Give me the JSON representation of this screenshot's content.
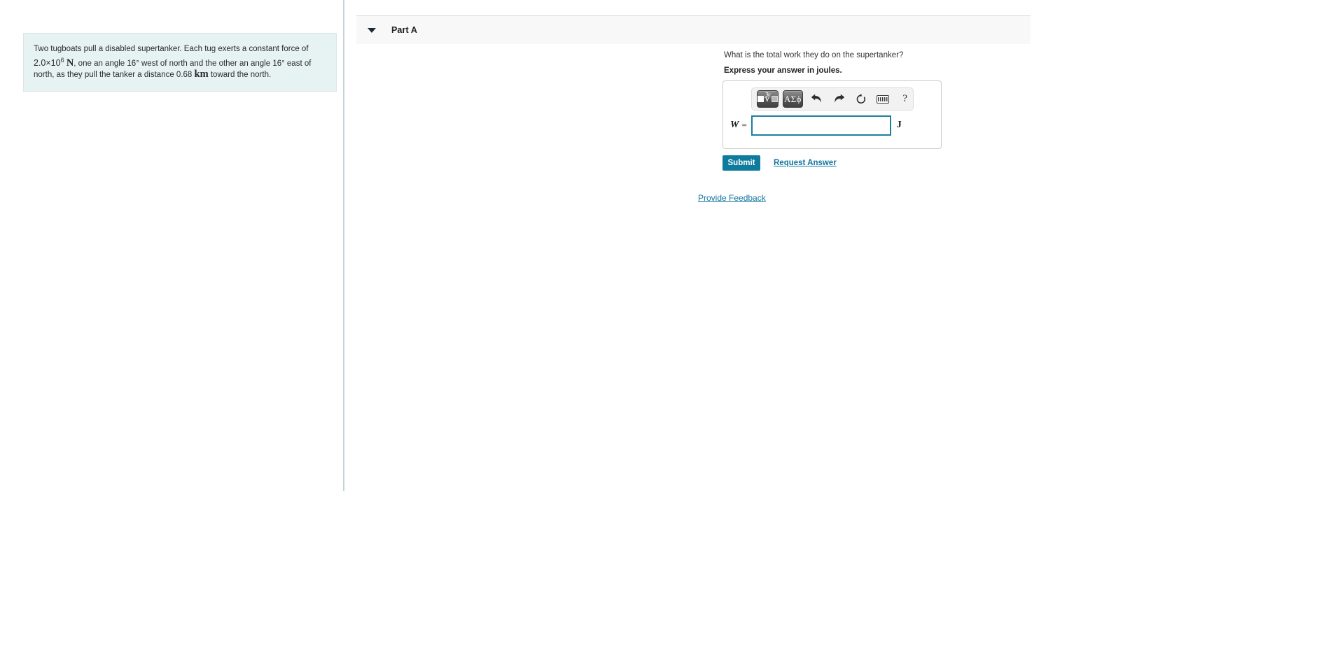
{
  "problem": {
    "text_part1": "Two tugboats pull a disabled supertanker. Each tug exerts a constant force of ",
    "force_value": "2.0×10",
    "force_exponent": "6",
    "force_unit": "N",
    "text_part2": ", one an angle 16",
    "deg1": "°",
    "text_part3": " west of north and the other an angle 16",
    "deg2": "°",
    "text_part4": " east of north, as they pull the tanker a distance 0.68 ",
    "distance_unit": "km",
    "text_part5": " toward the north."
  },
  "part": {
    "title": "Part A",
    "collapse_icon": "triangle-down-icon",
    "question": "What is the total work they do on the supertanker?",
    "instruction": "Express your answer in joules."
  },
  "answer_widget": {
    "toolbar": {
      "template_button_label": "√",
      "template_button_name": "math-template-icon",
      "greek_button_label": "ΑΣϕ",
      "undo_icon": "undo-arrow-icon",
      "redo_icon": "redo-arrow-icon",
      "reset_icon": "reset-circle-icon",
      "keyboard_icon": "keyboard-icon",
      "help_icon": "?"
    },
    "variable_label": "W",
    "equals_label": "=",
    "input_value": "",
    "input_placeholder": "",
    "unit_label": "J"
  },
  "actions": {
    "submit_label": "Submit",
    "request_answer_label": "Request Answer",
    "provide_feedback_label": "Provide Feedback"
  },
  "colors": {
    "accent": "#0f7c9e",
    "link": "#1275a0",
    "problem_bg": "#e7f2f2",
    "panel_bg": "#f8f8f8",
    "input_border": "#1b7fa0"
  }
}
